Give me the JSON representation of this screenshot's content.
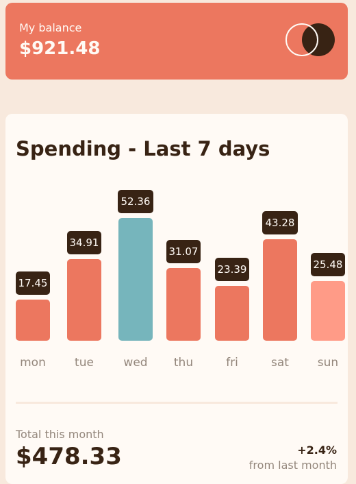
{
  "balance": {
    "label": "My balance",
    "amount": "$921.48"
  },
  "spending": {
    "title": "Spending - Last 7 days"
  },
  "chart_data": {
    "type": "bar",
    "categories": [
      "mon",
      "tue",
      "wed",
      "thu",
      "fri",
      "sat",
      "sun"
    ],
    "values": [
      17.45,
      34.91,
      52.36,
      31.07,
      23.39,
      43.28,
      25.48
    ],
    "value_labels": [
      "17.45",
      "34.91",
      "52.36",
      "31.07",
      "23.39",
      "43.28",
      "25.48"
    ],
    "highlight_index": 2,
    "colors": {
      "default": "#ec775f",
      "highlight": "#76b5bc",
      "sunday": "#ff9b87",
      "label_bg": "#382314"
    }
  },
  "summary": {
    "total_label": "Total this month",
    "total_amount": "$478.33",
    "change_percent": "+2.4%",
    "change_label": "from last month"
  },
  "icons": {
    "logo": "two-circles-logo-icon"
  }
}
